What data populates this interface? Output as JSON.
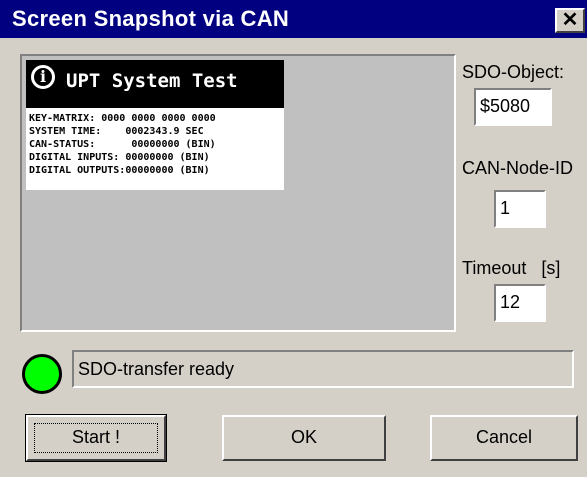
{
  "window": {
    "title": "Screen Snapshot via CAN",
    "close_label": "✕"
  },
  "screen": {
    "title": "UPT System Test",
    "info_icon": "i",
    "lines": [
      "KEY-MATRIX: 0000 0000 0000 0000",
      "SYSTEM TIME:    0002343.9 SEC",
      "CAN-STATUS:      00000000 (BIN)",
      "DIGITAL INPUTS: 00000000 (BIN)",
      "DIGITAL OUTPUTS:00000000 (BIN)"
    ]
  },
  "sdo_object": {
    "label": "SDO-Object:",
    "value": "$5080"
  },
  "can_node": {
    "label": "CAN-Node-ID",
    "value": "1"
  },
  "timeout": {
    "label": "Timeout   [s]",
    "value": "12"
  },
  "status": {
    "text": "SDO-transfer ready",
    "led_color": "#00ff00"
  },
  "buttons": {
    "start": "Start !",
    "ok": "OK",
    "cancel": "Cancel"
  },
  "colors": {
    "titlebar": "#000080",
    "face": "#d4d0c8"
  }
}
